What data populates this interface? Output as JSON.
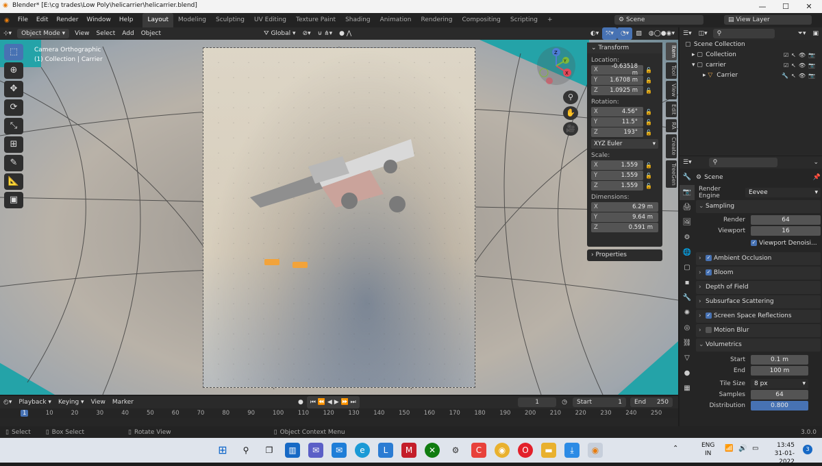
{
  "window": {
    "title": "Blender* [E:\\cg trades\\Low Poly\\helicarrier\\helicarrier.blend]",
    "min": "—",
    "max": "☐",
    "close": "✕"
  },
  "menu": {
    "items": [
      "File",
      "Edit",
      "Render",
      "Window",
      "Help"
    ],
    "workspaces": [
      "Layout",
      "Modeling",
      "Sculpting",
      "UV Editing",
      "Texture Paint",
      "Shading",
      "Animation",
      "Rendering",
      "Compositing",
      "Scripting"
    ],
    "add": "+",
    "scene": "Scene",
    "viewlayer": "View Layer"
  },
  "vphead": {
    "mode": "Object Mode",
    "view": "View",
    "select": "Select",
    "add": "Add",
    "object": "Object",
    "orientation": "Global"
  },
  "viewport": {
    "camera": "Camera Orthographic",
    "collection": "(1) Collection | Carrier"
  },
  "npanel": {
    "title": "Transform",
    "location_label": "Location:",
    "location": [
      "-0.63518 m",
      "1.6708 m",
      "1.0925 m"
    ],
    "rotation_label": "Rotation:",
    "rotation": [
      "4.56°",
      "11.5°",
      "193°"
    ],
    "euler": "XYZ Euler",
    "scale_label": "Scale:",
    "scale": [
      "1.559",
      "1.559",
      "1.559"
    ],
    "dimensions_label": "Dimensions:",
    "dimensions": [
      "6.29 m",
      "9.64 m",
      "0.591 m"
    ],
    "axes": [
      "X",
      "Y",
      "Z"
    ],
    "properties": "Properties",
    "tabs": [
      "Item",
      "Tool",
      "View",
      "Edit",
      "RA",
      "Create",
      "TreeGen"
    ]
  },
  "outliner": {
    "root": "Scene Collection",
    "rows": [
      "Collection",
      "carrier",
      "Carrier"
    ]
  },
  "props": {
    "scene": "Scene",
    "engine_label": "Render Engine",
    "engine": "Eevee",
    "sampling": "Sampling",
    "render_label": "Render",
    "render": "64",
    "viewport_label": "Viewport",
    "viewport": "16",
    "denoise": "Viewport Denoisi...",
    "sections": [
      "Ambient Occlusion",
      "Bloom",
      "Depth of Field",
      "Subsurface Scattering",
      "Screen Space Reflections",
      "Motion Blur"
    ],
    "volumetrics": "Volumetrics",
    "start_label": "Start",
    "start": "0.1 m",
    "end_label": "End",
    "end": "100 m",
    "tile_label": "Tile Size",
    "tile": "8 px",
    "samples_label": "Samples",
    "samples": "64",
    "dist_label": "Distribution",
    "dist": "0.800"
  },
  "timeline": {
    "playback": "Playback",
    "keying": "Keying",
    "view": "View",
    "marker": "Marker",
    "frame": "1",
    "start_label": "Start",
    "start": "1",
    "end_label": "End",
    "end": "250",
    "ticks": [
      "1",
      "10",
      "20",
      "30",
      "40",
      "50",
      "60",
      "70",
      "80",
      "90",
      "100",
      "110",
      "120",
      "130",
      "140",
      "150",
      "160",
      "170",
      "180",
      "190",
      "200",
      "210",
      "220",
      "230",
      "240",
      "250"
    ]
  },
  "status": {
    "select": "Select",
    "box": "Box Select",
    "rotate": "Rotate View",
    "context": "Object Context Menu",
    "version": "3.0.0"
  },
  "tray": {
    "lang1": "ENG",
    "lang2": "IN",
    "time": "13:45",
    "date": "31-01-2022",
    "badge": "3"
  }
}
